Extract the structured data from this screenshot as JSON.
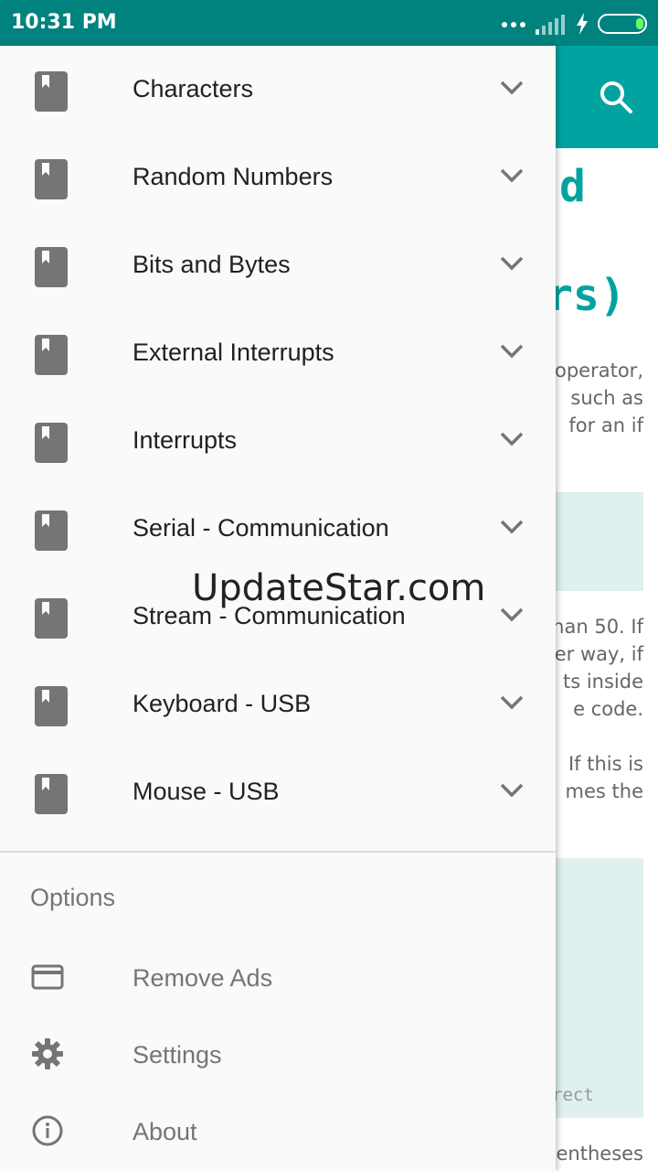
{
  "status_bar": {
    "time": "10:31 PM",
    "icons": [
      "more-dots-icon",
      "signal-icon",
      "charging-bolt-icon",
      "battery-icon"
    ]
  },
  "background": {
    "heading_line1": "d",
    "heading_line2": "rs)",
    "para1": [
      "operator,",
      "such as",
      "for an if"
    ],
    "para2": [
      "han 50. If",
      "er way, if",
      "ts inside",
      "e code."
    ],
    "para3": [
      "If this is",
      "mes the"
    ],
    "code_fragment": "rect",
    "bottom_text": "entheses"
  },
  "drawer": {
    "categories": [
      {
        "label": "Characters"
      },
      {
        "label": "Random Numbers"
      },
      {
        "label": "Bits and Bytes"
      },
      {
        "label": "External Interrupts"
      },
      {
        "label": "Interrupts"
      },
      {
        "label": "Serial - Communication"
      },
      {
        "label": "Stream - Communication"
      },
      {
        "label": "Keyboard - USB"
      },
      {
        "label": "Mouse - USB"
      }
    ],
    "options_header": "Options",
    "options": [
      {
        "label": "Remove Ads",
        "icon": "credit-card-icon"
      },
      {
        "label": "Settings",
        "icon": "gear-icon"
      },
      {
        "label": "About",
        "icon": "info-icon"
      }
    ]
  },
  "watermark": "UpdateStar.com",
  "colors": {
    "status_bar": "#00827f",
    "accent": "#00a3a0",
    "drawer_bg": "#fafafa",
    "code_bg": "#dff0ee"
  }
}
